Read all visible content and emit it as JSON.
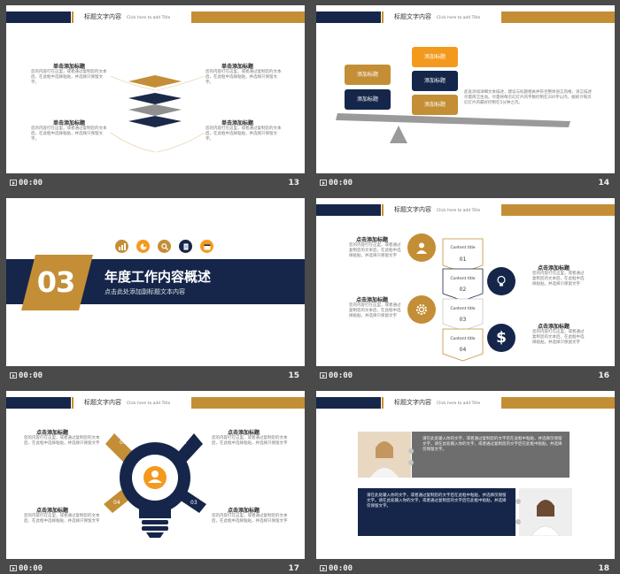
{
  "header": {
    "title": "标题文字内容",
    "subtitle": "Click here to add Title"
  },
  "colors": {
    "navy": "#15264a",
    "gold": "#c48e36",
    "orange": "#f39a1e",
    "gray": "#9a9a9a"
  },
  "slides": [
    {
      "time": "00:00",
      "number": "13",
      "blocks": [
        {
          "title": "单击添加标题",
          "text": "您的内容打在这里，或者通过复制您的文本后，在此框中选择粘贴，并选择只保留文字。"
        },
        {
          "title": "单击添加标题",
          "text": "您的内容打在这里，或者通过复制您的文本后，在此框中选择粘贴，并选择只保留文字。"
        },
        {
          "title": "单击添加标题",
          "text": "您的内容打在这里，或者通过复制您的文本后，在此框中选择粘贴，并选择只保留文字。"
        },
        {
          "title": "单击添加标题",
          "text": "您的内容打在这里，或者通过复制您的文本后，在此框中选择粘贴，并选择只保留文字。"
        }
      ]
    },
    {
      "time": "00:00",
      "number": "14",
      "boxes": [
        "添加标题",
        "添加标题",
        "添加标题",
        "添加标题",
        "添加标题"
      ],
      "text": "此处添加详细文本描述，建议与标题相关并符合整体语言风格，语言描述尽量简洁生动。尽量将每页幻灯片的字数控制在200字以内，据统计每页幻灯片的最好控制在5分钟之内。"
    },
    {
      "time": "00:00",
      "number": "15",
      "section": "03",
      "title": "年度工作内容概述",
      "subtitle": "点击此处添加副标题文本内容",
      "icons": [
        "chart-icon",
        "pie-icon",
        "search-icon",
        "document-icon",
        "calendar-icon"
      ]
    },
    {
      "time": "00:00",
      "number": "16",
      "blocks": [
        {
          "title": "点击添加标题",
          "text": "您的内容打在这里，或者通过复制您的文本后，在此框中选择粘贴，并选择只保留文字"
        },
        {
          "title": "点击添加标题",
          "text": "您的内容打在这里，或者通过复制您的文本后，在此框中选择粘贴，并选择只保留文字"
        },
        {
          "title": "点击添加标题",
          "text": "您的内容打在这里，或者通过复制您的文本后，在此框中选择粘贴，并选择只保留文字"
        },
        {
          "title": "点击添加标题",
          "text": "您的内容打在这里，或者通过复制您的文本后，在此框中选择粘贴，并选择只保留文字"
        }
      ],
      "steps": [
        {
          "label": "Content title",
          "num": "01"
        },
        {
          "label": "Content title",
          "num": "02"
        },
        {
          "label": "Content title",
          "num": "03"
        },
        {
          "label": "Content title",
          "num": "04"
        }
      ]
    },
    {
      "time": "00:00",
      "number": "17",
      "blocks": [
        {
          "title": "点击添加标题",
          "text": "您的内容打在这里，或者通过复制您的文本后，在此框中选择粘贴，并选择只保留文字"
        },
        {
          "title": "点击添加标题",
          "text": "您的内容打在这里，或者通过复制您的文本后，在此框中选择粘贴，并选择只保留文字"
        },
        {
          "title": "点击添加标题",
          "text": "您的内容打在这里，或者通过复制您的文本后，在此框中选择粘贴，并选择只保留文字"
        },
        {
          "title": "点击添加标题",
          "text": "您的内容打在这里，或者通过复制您的文本后，在此框中选择粘贴，并选择只保留文字"
        }
      ],
      "petals": [
        "01",
        "02",
        "03",
        "04"
      ]
    },
    {
      "time": "00:00",
      "number": "18",
      "text1": "请在此处输入你的文字，或者通过复制您的文字后在此框中粘贴，并选择仅保留文字。请在此处输入你的文字，或者通过复制您的文字后在此框中粘贴，并选择仅保留文字。",
      "text2": "请在此处输入你的文字，或者通过复制您的文字后在此框中粘贴，并选择仅保留文字。请在此处输入你的文字，或者通过复制您的文字后在此框中粘贴，并选择仅保留文字。"
    }
  ]
}
